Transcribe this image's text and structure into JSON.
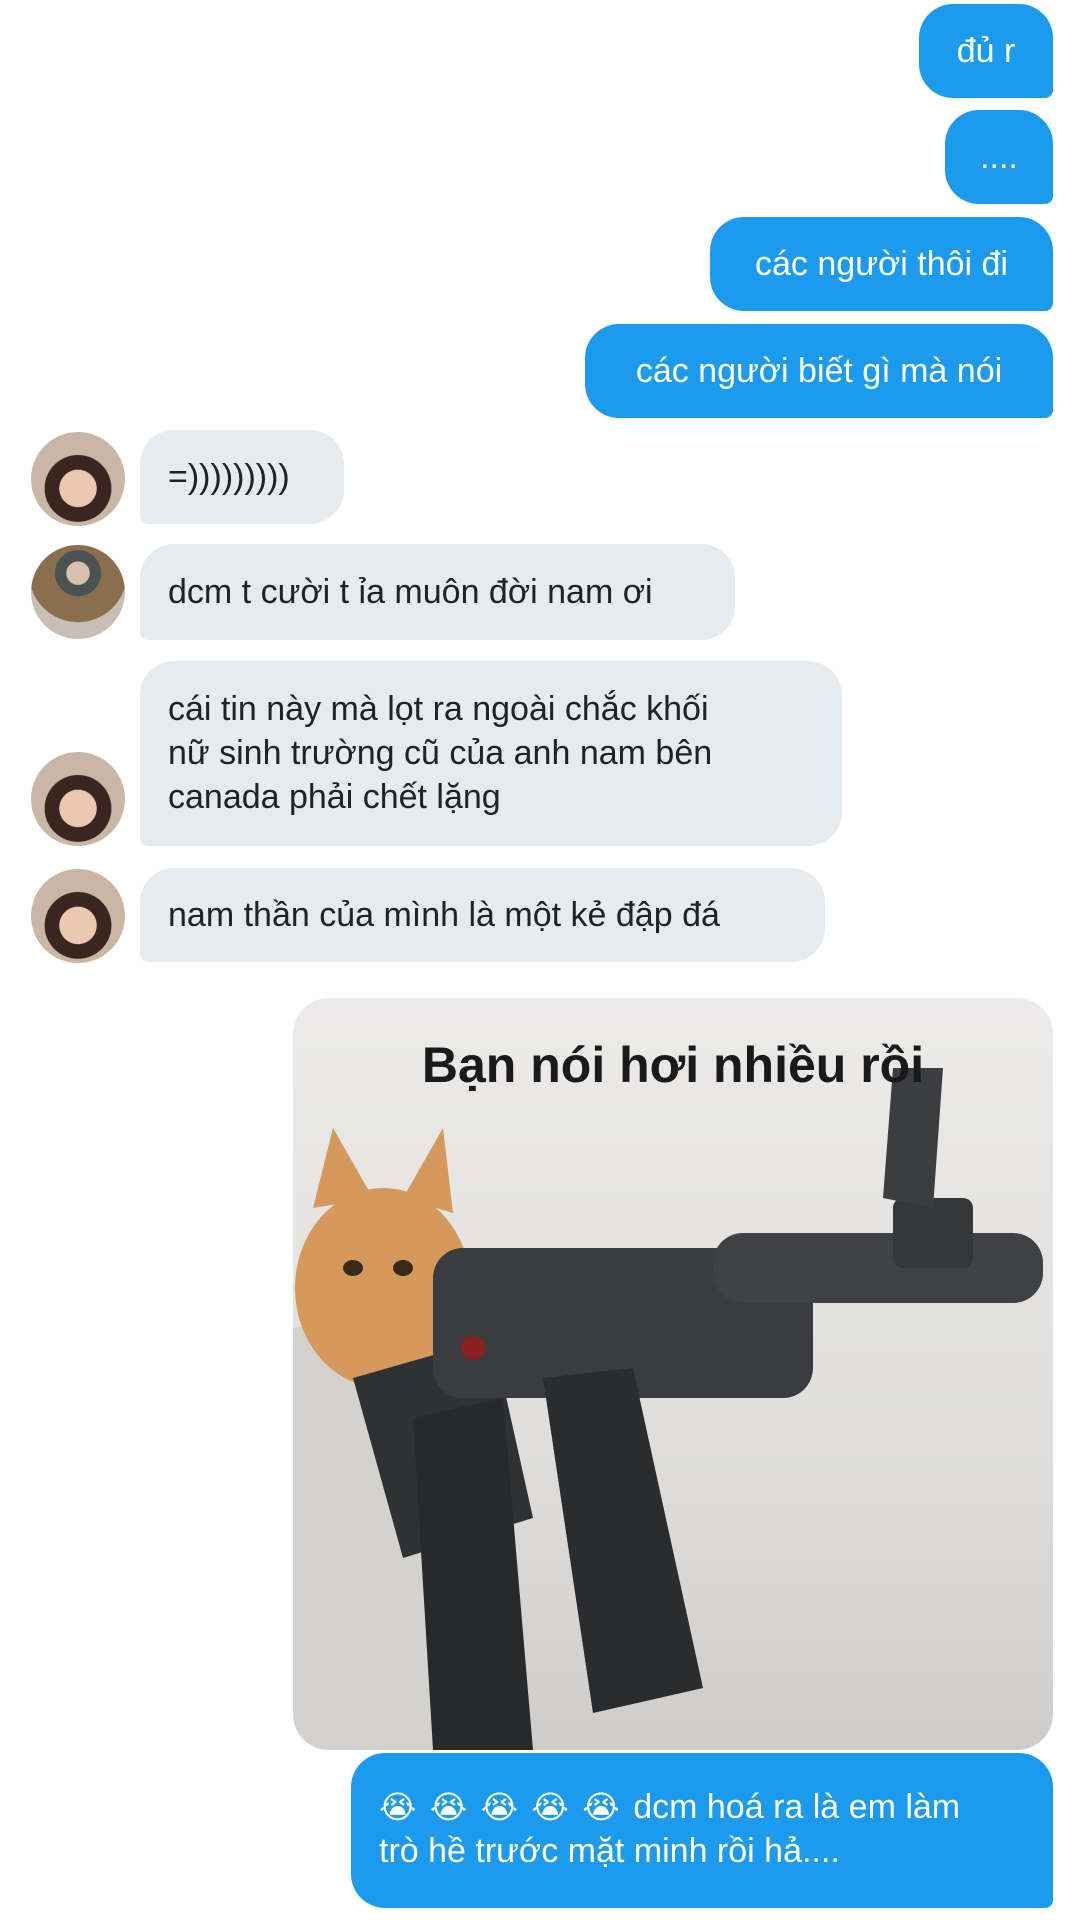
{
  "messages": {
    "m1": "đủ r",
    "m2": "....",
    "m3": "các người thôi đi",
    "m4": "các người biết gì mà nói",
    "m5": "=)))))))))",
    "m6": "dcm t cười t ỉa muôn đời nam ơi",
    "m7": [
      "cái tin này mà lọt ra ngoài chắc khối",
      "nữ sinh trường cũ của anh nam bên",
      "canada phải chết lặng"
    ],
    "m8": "nam thần của mình là một kẻ đập đá",
    "meme_caption": "Bạn nói hơi nhiều rồi",
    "m9": {
      "emojis": [
        "😭",
        "😭",
        "😭",
        "😭",
        "😭"
      ],
      "line1": "dcm hoá ra là em làm",
      "line2": "trò hề trước mặt minh rồi hả...."
    }
  },
  "colors": {
    "outgoing": "#1c9bee",
    "incoming": "#e6ebf0"
  },
  "icons": {
    "meme_subject": "cat-with-rifle",
    "avatar_a": "person-photo",
    "avatar_b": "person-photo"
  }
}
